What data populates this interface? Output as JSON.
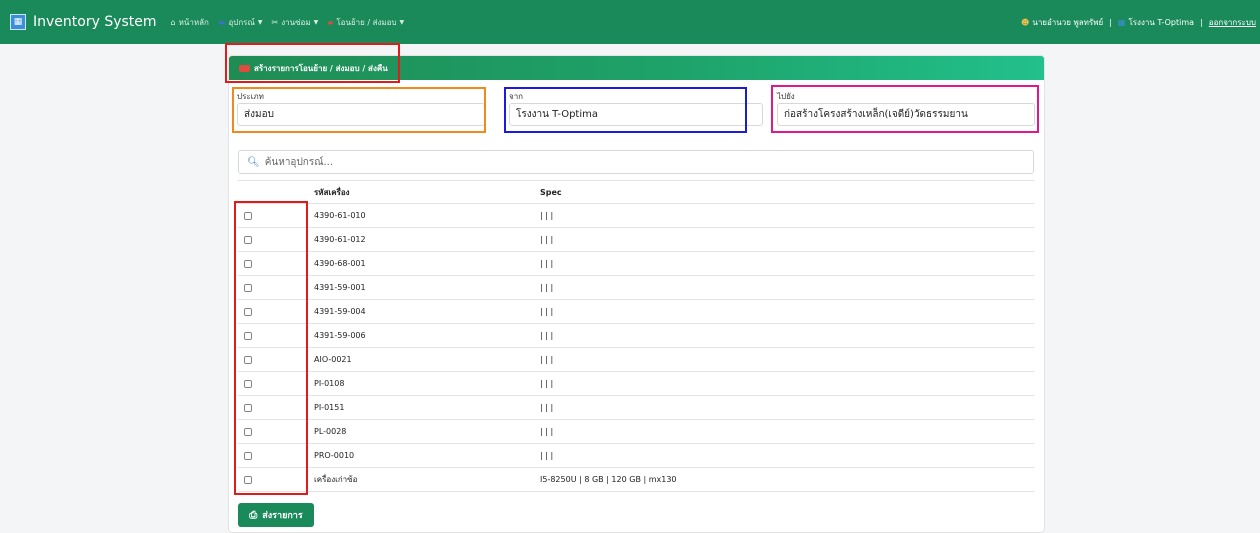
{
  "navbar": {
    "brand": "Inventory System",
    "menu": [
      {
        "label": "หน้าหลัก",
        "icon": "home-icon",
        "glyph": "⌂"
      },
      {
        "label": "อุปกรณ์",
        "icon": "laptop-icon",
        "glyph": "▬"
      },
      {
        "label": "งานซ่อม",
        "icon": "tools-icon",
        "glyph": "✂"
      },
      {
        "label": "โอนย้าย / ส่งมอบ",
        "icon": "truck-icon",
        "glyph": "▰"
      }
    ],
    "user": "นายอำนวย พูลทรัพย์",
    "site": "โรงงาน T-Optima",
    "separator": "|",
    "logout": "ออกจากระบบ"
  },
  "card": {
    "title": "สร้างรายการโอนย้าย / ส่งมอบ / ส่งคืน",
    "type_label": "ประเภท",
    "type_value": "ส่งมอบ",
    "from_label": "จาก",
    "from_value": "โรงงาน T-Optima",
    "to_label": "ไปยัง",
    "to_value": "ก่อสร้างโครงสร้างเหล็ก(เจดีย์)วัดธรรมยาน",
    "search_placeholder": "ค้นหาอุปกรณ์...",
    "columns": [
      "",
      "รหัสเครื่อง",
      "Spec"
    ],
    "rows": [
      {
        "code": "4390-61-010",
        "spec": "| | |"
      },
      {
        "code": "4390-61-012",
        "spec": "| | |"
      },
      {
        "code": "4390-68-001",
        "spec": "| | |"
      },
      {
        "code": "4391-59-001",
        "spec": "| | |"
      },
      {
        "code": "4391-59-004",
        "spec": "| | |"
      },
      {
        "code": "4391-59-006",
        "spec": "| | |"
      },
      {
        "code": "AIO-0021",
        "spec": "| | |"
      },
      {
        "code": "PI-0108",
        "spec": "| | |"
      },
      {
        "code": "PI-0151",
        "spec": "| | |"
      },
      {
        "code": "PL-0028",
        "spec": "| | |"
      },
      {
        "code": "PRO-0010",
        "spec": "| | |"
      },
      {
        "code": "เครื่องเก่าซ้อ",
        "spec": "I5-8250U | 8 GB | 120 GB | mx130"
      }
    ],
    "submit_label": "ส่งรายการ"
  },
  "colors": {
    "navbar": "#1b8a5a",
    "header_start": "#1f8c55",
    "header_end": "#22c08c",
    "annotation_red": "#e01b1b",
    "annotation_orange": "#f08a1c",
    "annotation_blue": "#1a1ae0",
    "annotation_magenta": "#e0188c"
  }
}
